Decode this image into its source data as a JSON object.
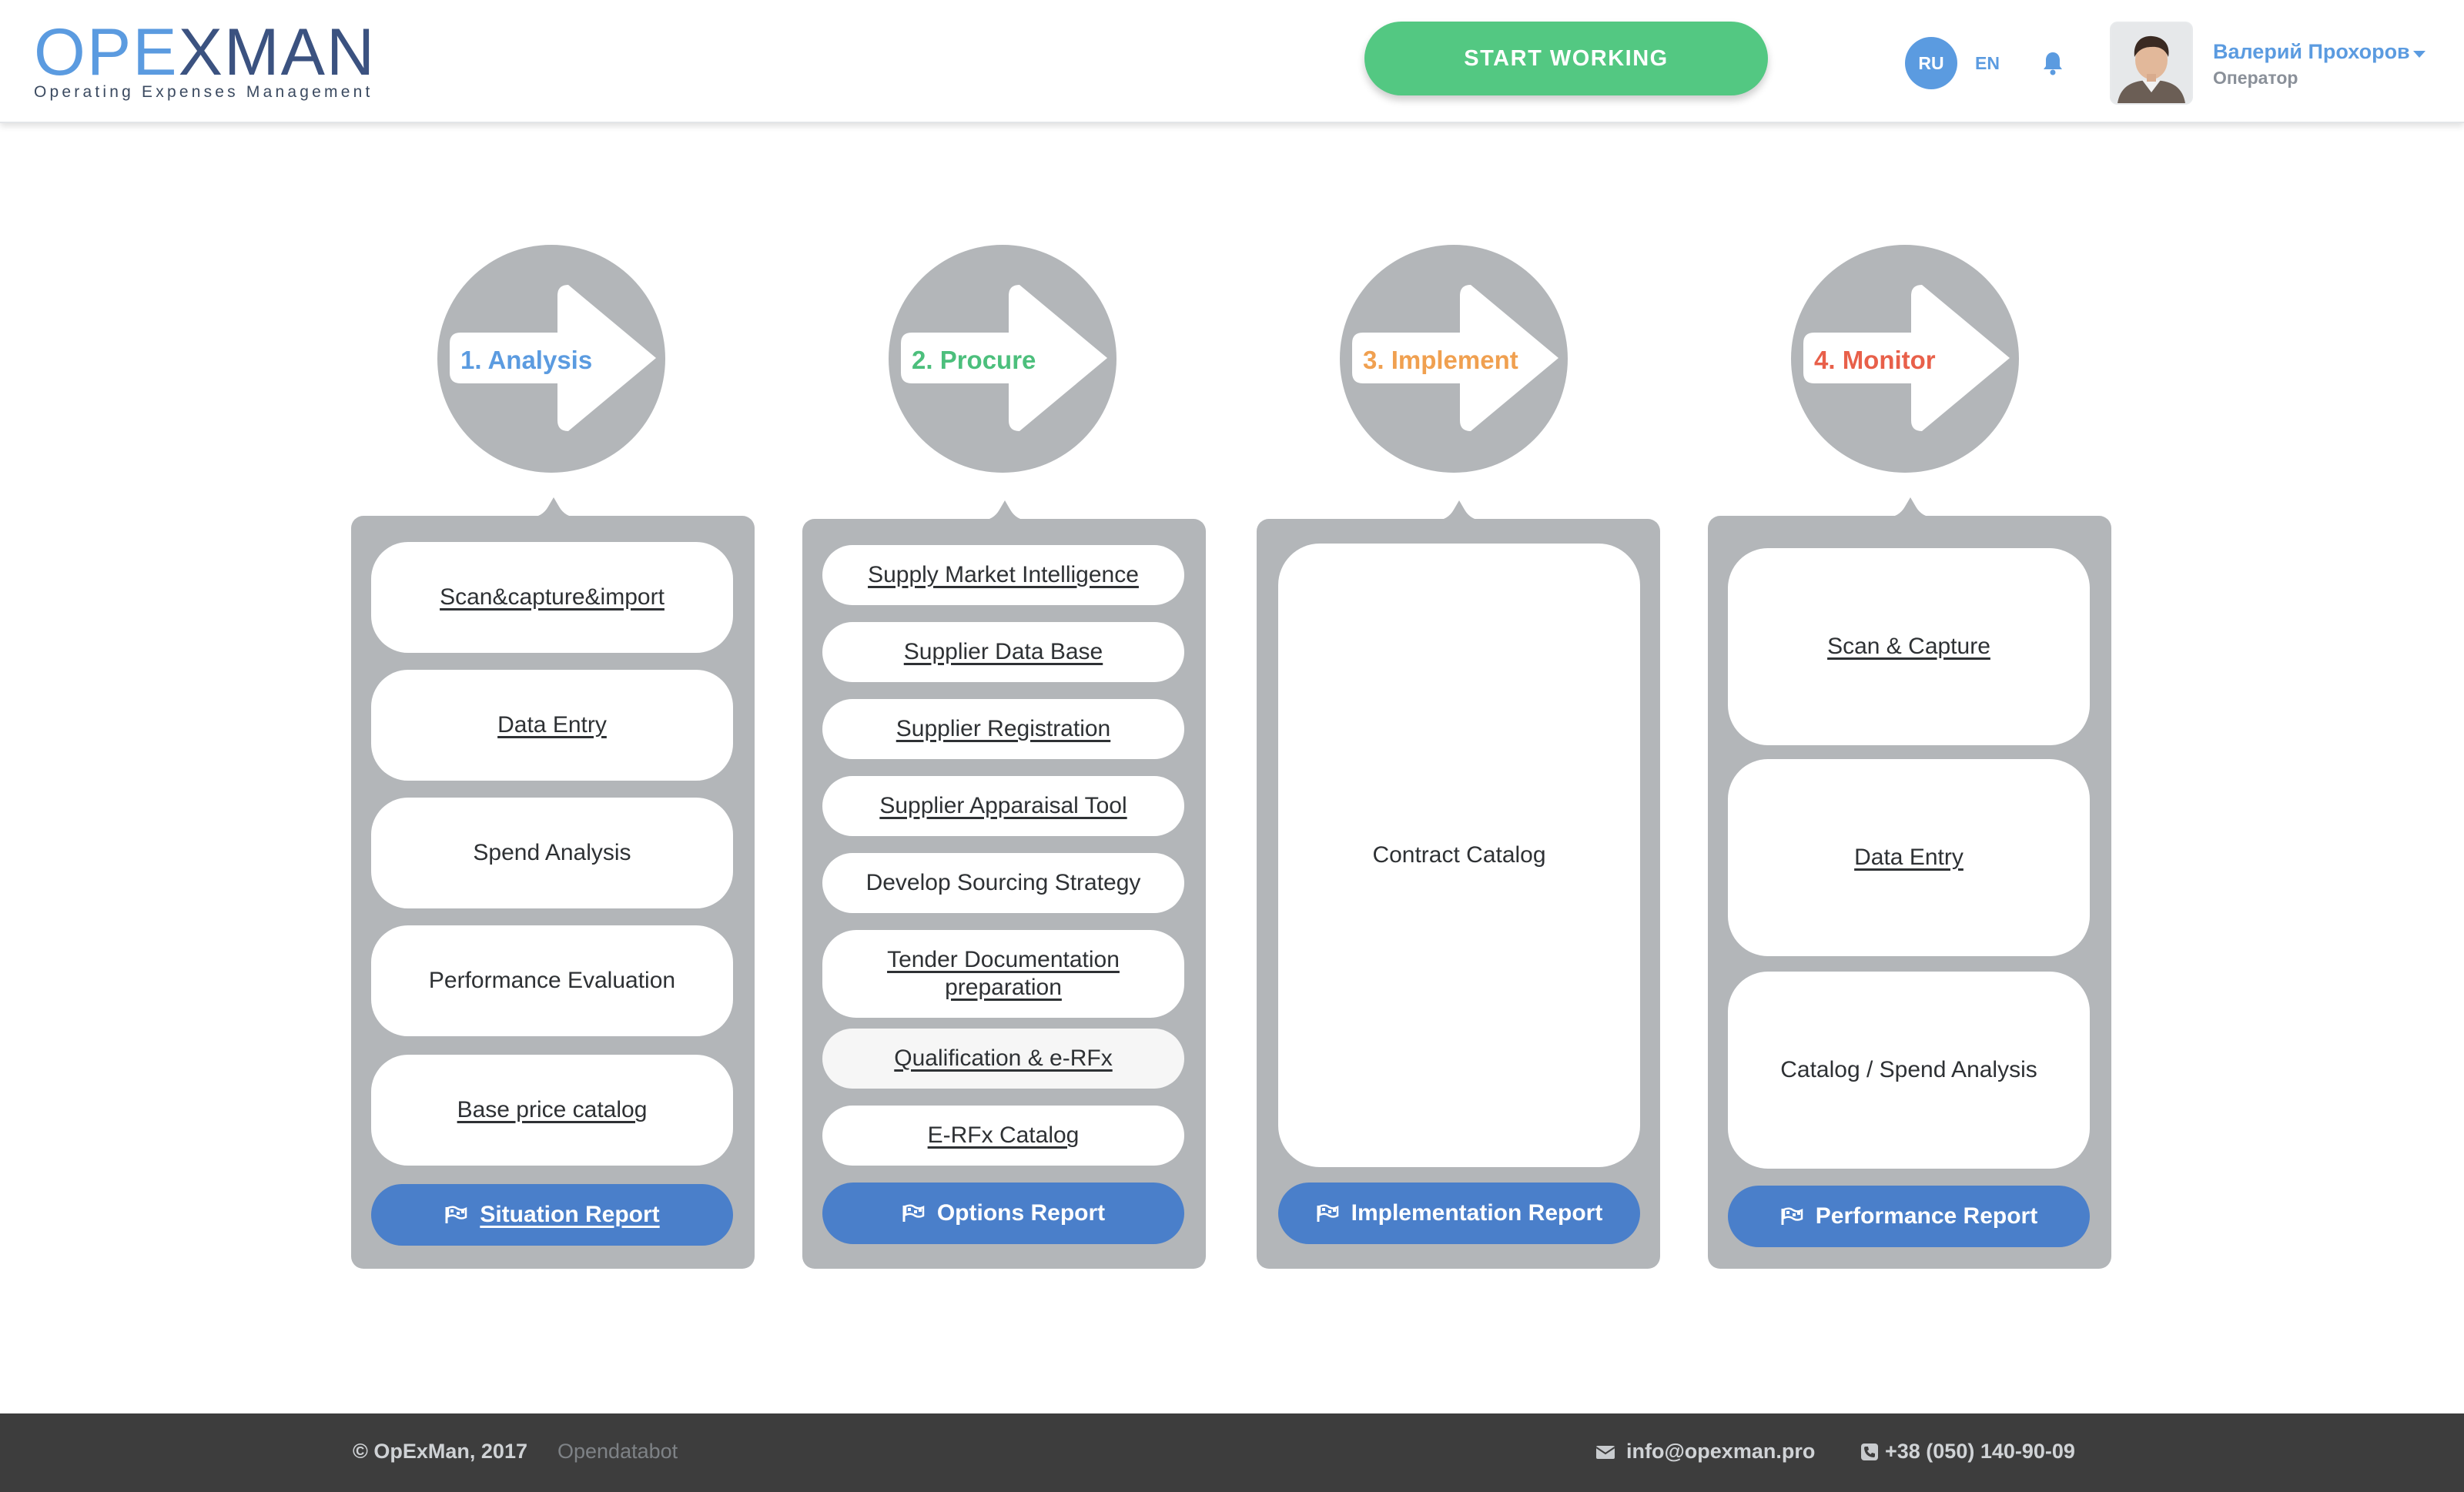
{
  "header": {
    "logo": {
      "word_part1": "OPE",
      "word_part2": "XMAN",
      "subtitle": "Operating Expenses Management"
    },
    "start_button": "START WORKING",
    "lang_ru": "RU",
    "lang_en": "EN",
    "user": {
      "name": "Валерий Прохоров",
      "role": "Оператор"
    }
  },
  "stages": [
    {
      "label": "1. Analysis",
      "color": "#5b9be0"
    },
    {
      "label": "2. Procure",
      "color": "#4cbf7c"
    },
    {
      "label": "3. Implement",
      "color": "#f0a050"
    },
    {
      "label": "4. Monitor",
      "color": "#e8604a"
    }
  ],
  "analysis": {
    "items": [
      "Scan&capture&import",
      "Data Entry",
      "Spend Analysis",
      "Performance Evaluation",
      "Base price catalog"
    ],
    "report": "Situation Report"
  },
  "procure": {
    "items": [
      "Supply Market Intelligence",
      "Supplier Data Base",
      "Supplier Registration",
      "Supplier Apparaisal Tool",
      "Develop Sourcing Strategy",
      "Tender Documentation preparation",
      "Qualification & e-RFx",
      "E-RFx Catalog"
    ],
    "report": "Options Report"
  },
  "implement": {
    "items": [
      "Contract Catalog"
    ],
    "report": "Implementation Report"
  },
  "monitor": {
    "items": [
      "Scan & Capture",
      "Data Entry",
      "Catalog / Spend Analysis"
    ],
    "report": "Performance Report"
  },
  "footer": {
    "copyright": "© OpExMan, 2017",
    "bot": "Opendatabot",
    "email": "info@opexman.pro",
    "phone": "+38 (050) 140-90-09"
  },
  "colors": {
    "button_blue": "#4a7fca",
    "start_green": "#53c882",
    "panel_gray": "#b3b6b9"
  },
  "icons": {
    "notification": "bell-icon",
    "report": "flag-icon",
    "email": "envelope-icon",
    "phone": "phone-icon",
    "user_menu": "caret-down-icon"
  }
}
